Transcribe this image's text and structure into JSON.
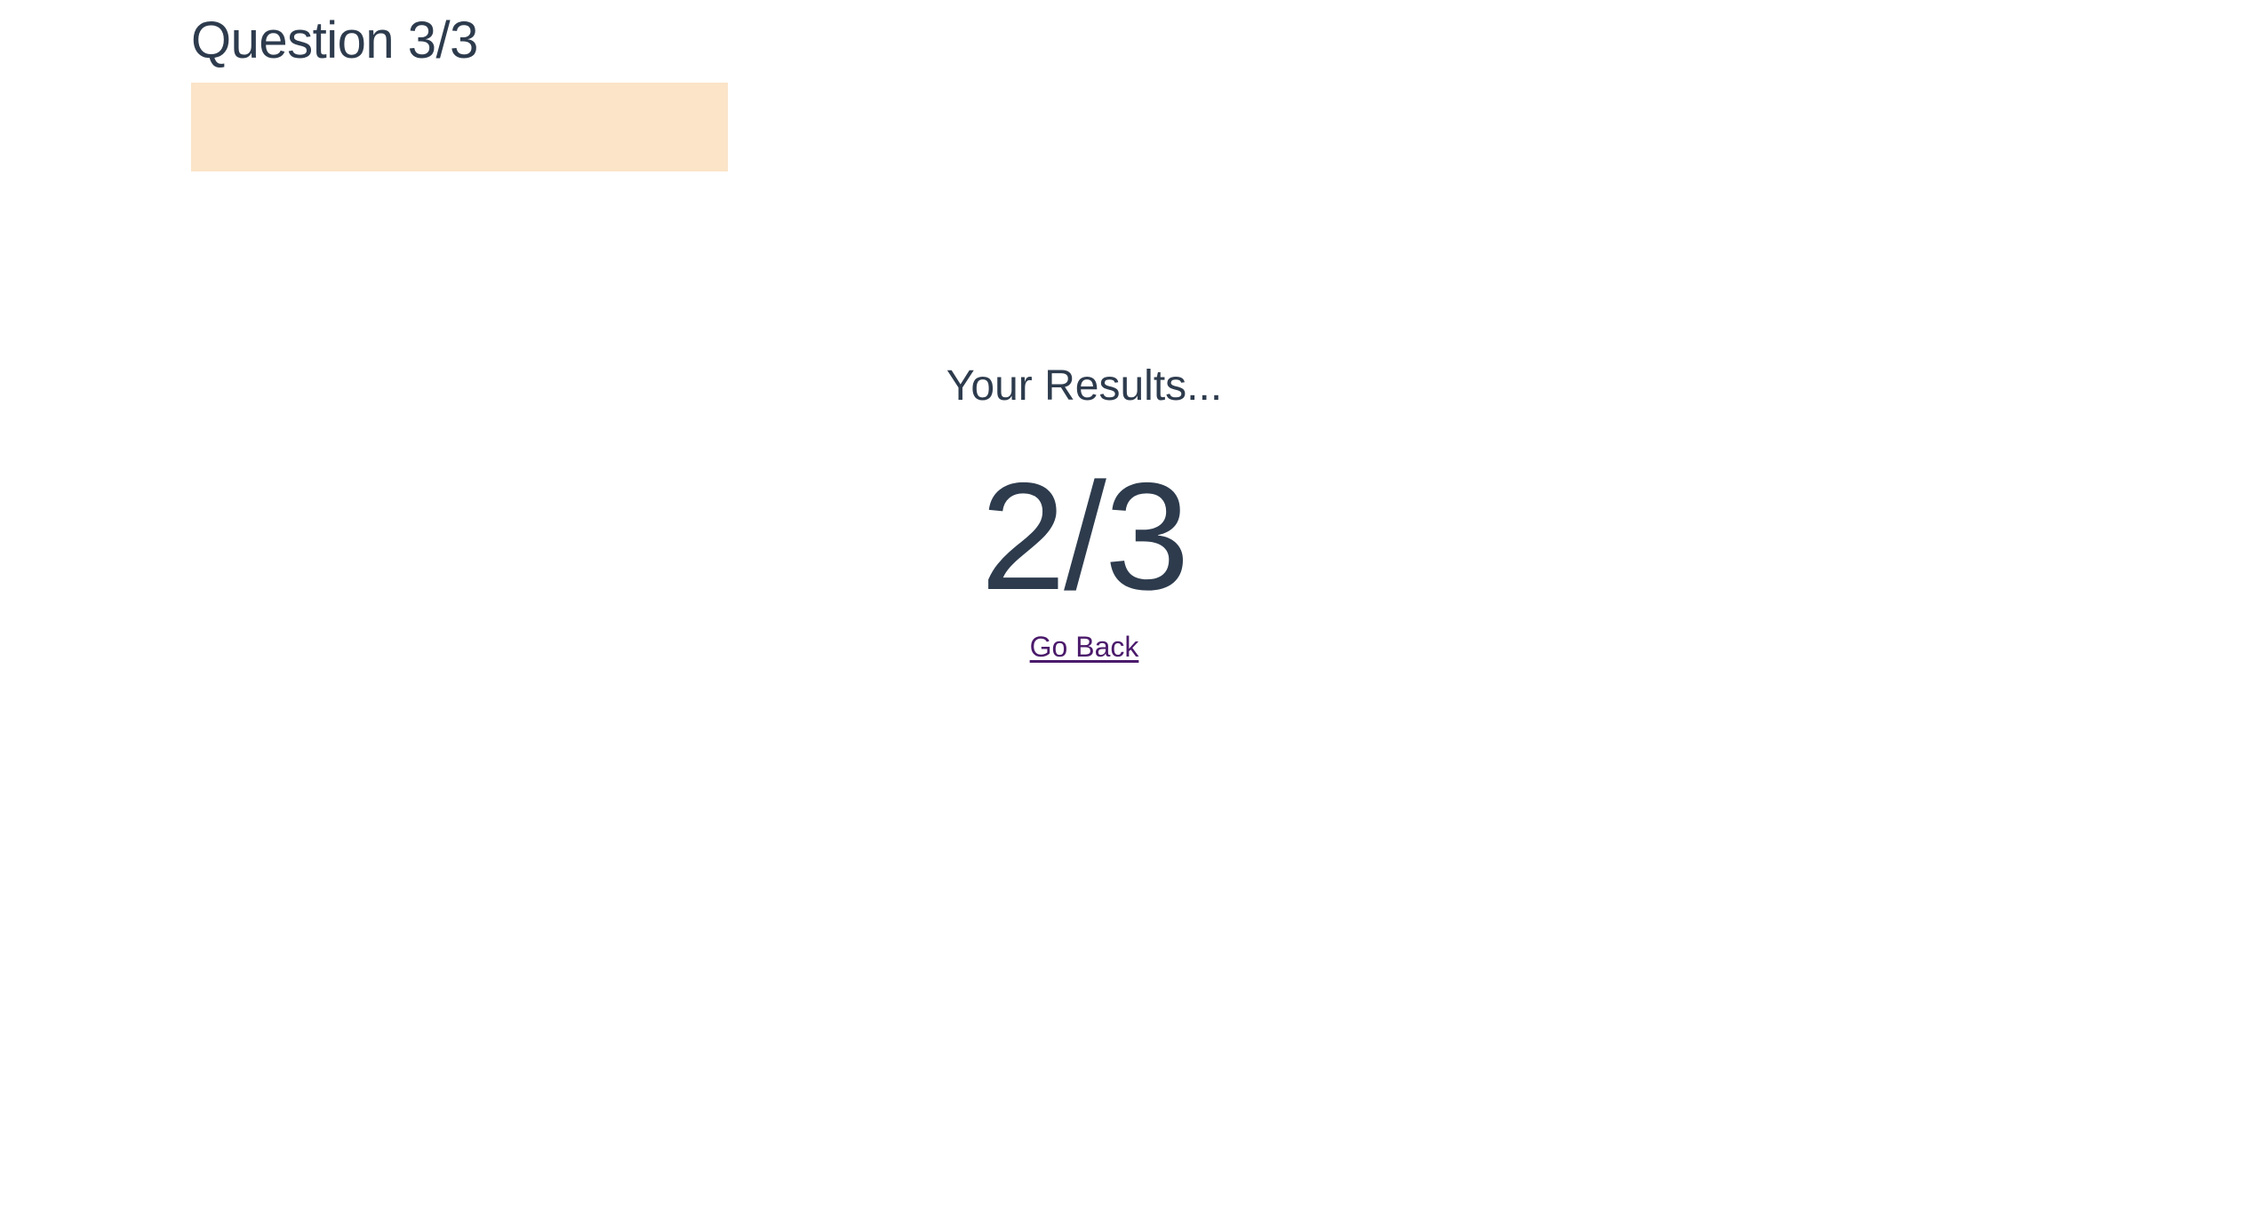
{
  "quiz": {
    "question_label": "Question 3/3",
    "progress": 1.0,
    "progress_color": "#fbe4c8"
  },
  "results": {
    "heading": "Your Results...",
    "score": "2/3",
    "go_back_label": "Go Back",
    "link_color": "#4b1a6b",
    "text_color": "#2d3b4d"
  }
}
